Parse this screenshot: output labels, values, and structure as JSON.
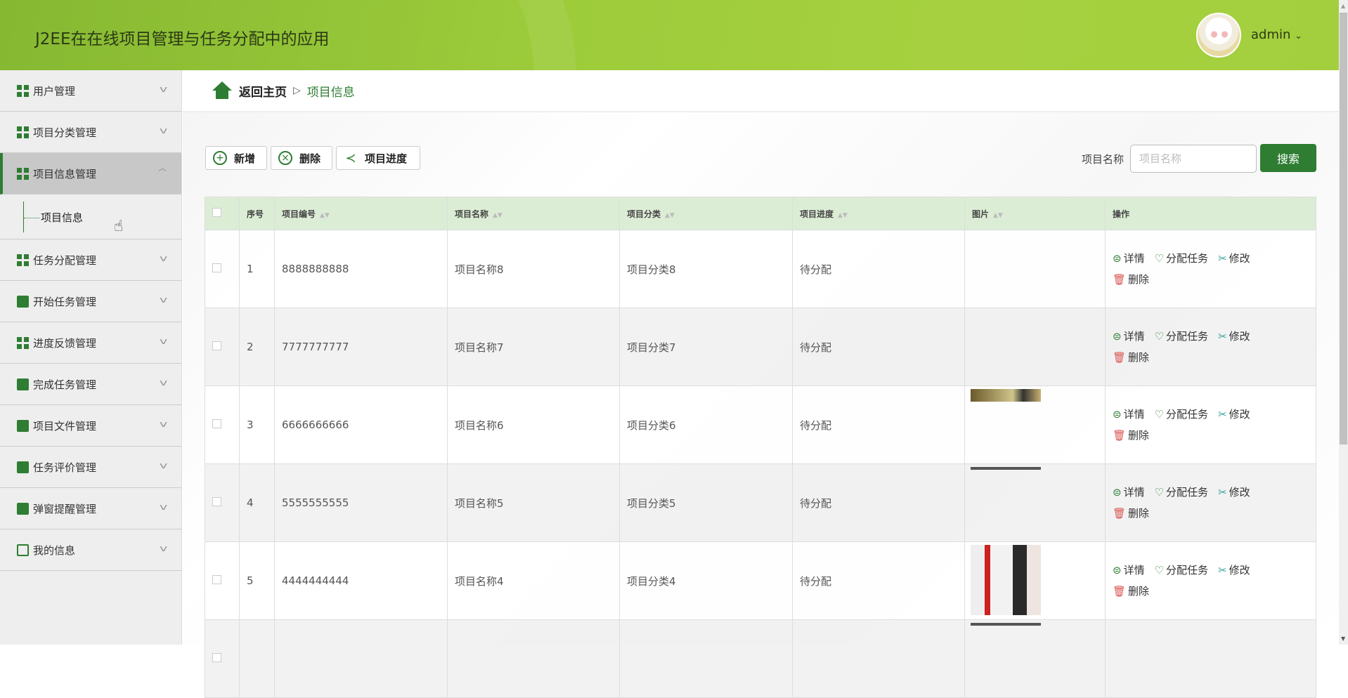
{
  "header": {
    "title": "J2EE在在线项目管理与任务分配中的应用",
    "user": "admin",
    "user_caret": "⌄"
  },
  "sidebar": {
    "items": [
      {
        "label": "用户管理",
        "icon": "grid"
      },
      {
        "label": "项目分类管理",
        "icon": "grid"
      },
      {
        "label": "项目信息管理",
        "icon": "grid",
        "active": true
      },
      {
        "label": "任务分配管理",
        "icon": "grid"
      },
      {
        "label": "开始任务管理",
        "icon": "solid"
      },
      {
        "label": "进度反馈管理",
        "icon": "grid"
      },
      {
        "label": "完成任务管理",
        "icon": "solid"
      },
      {
        "label": "项目文件管理",
        "icon": "solid"
      },
      {
        "label": "任务评价管理",
        "icon": "solid"
      },
      {
        "label": "弹窗提醒管理",
        "icon": "solid"
      },
      {
        "label": "我的信息",
        "icon": "outline"
      }
    ],
    "submenu": "项目信息"
  },
  "breadcrumb": {
    "home": "返回主页",
    "sep": "▷",
    "current": "项目信息"
  },
  "toolbar": {
    "add": "新增",
    "add_icon": "+",
    "delete": "删除",
    "delete_icon": "×",
    "progress": "项目进度",
    "progress_icon": "≺"
  },
  "search": {
    "label": "项目名称",
    "placeholder": "项目名称",
    "button": "搜索"
  },
  "table": {
    "headers": [
      "序号",
      "项目编号",
      "项目名称",
      "项目分类",
      "项目进度",
      "图片",
      "操作"
    ],
    "sort_icon": "▲▼",
    "actions": {
      "detail": "详情",
      "assign": "分配任务",
      "edit": "修改",
      "delete": "删除"
    },
    "rows": [
      {
        "no": "1",
        "code": "8888888888",
        "name": "项目名称8",
        "category": "项目分类8",
        "progress": "待分配",
        "image": "none"
      },
      {
        "no": "2",
        "code": "7777777777",
        "name": "项目名称7",
        "category": "项目分类7",
        "progress": "待分配",
        "image": "none"
      },
      {
        "no": "3",
        "code": "6666666666",
        "name": "项目名称6",
        "category": "项目分类6",
        "progress": "待分配",
        "image": "partial"
      },
      {
        "no": "4",
        "code": "5555555555",
        "name": "项目名称5",
        "category": "项目分类5",
        "progress": "待分配",
        "image": "strip"
      },
      {
        "no": "5",
        "code": "4444444444",
        "name": "项目名称4",
        "category": "项目分类4",
        "progress": "待分配",
        "image": "full"
      },
      {
        "no": "",
        "code": "",
        "name": "",
        "category": "",
        "progress": "",
        "image": "strip"
      }
    ]
  },
  "colors": {
    "accent": "#2e7d32",
    "header": "#a3cf3e",
    "table_header": "#dcedd5"
  }
}
